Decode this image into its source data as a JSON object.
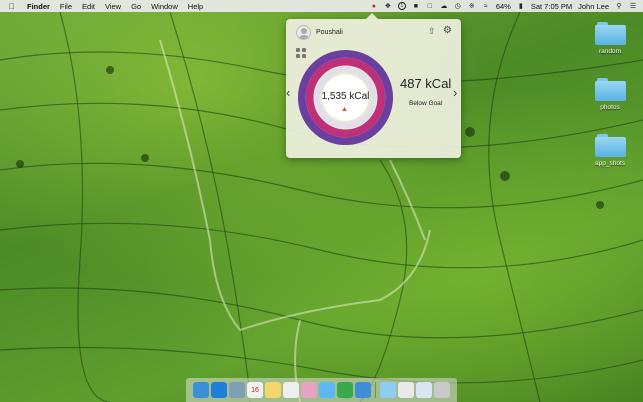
{
  "menubar": {
    "app_name": "Finder",
    "menus": [
      "File",
      "Edit",
      "View",
      "Go",
      "Window",
      "Help"
    ],
    "battery": "64%",
    "clock": "Sat 7:05 PM",
    "user": "John Lee"
  },
  "popover": {
    "user_name": "Poushali",
    "calories_consumed": "1,535 kCal",
    "remaining": "487 kCal",
    "status": "Below Goal",
    "ring_colors": {
      "outer": "#6a3fa0",
      "inner": "#c0307a",
      "track": "#e4ddef"
    }
  },
  "desktop": {
    "items": [
      "random",
      "photos",
      "app_shots"
    ]
  },
  "dock": {
    "apps": [
      {
        "icon": "finder-icon",
        "color": "#3b8fd6"
      },
      {
        "icon": "safari-icon",
        "color": "#1f7fd8"
      },
      {
        "icon": "mail-icon",
        "color": "#7f9fb8"
      },
      {
        "icon": "calendar-icon",
        "color": "#f2f2f2",
        "text": "16"
      },
      {
        "icon": "notes-icon",
        "color": "#f4d66a"
      },
      {
        "icon": "reminders-icon",
        "color": "#eeeeee"
      },
      {
        "icon": "photos-icon",
        "color": "#e6a3c4"
      },
      {
        "icon": "messages-icon",
        "color": "#5ab9f5"
      },
      {
        "icon": "facetime-icon",
        "color": "#3ba94a"
      },
      {
        "icon": "xcode-icon",
        "color": "#3d8ed6"
      },
      {
        "icon": "folder-icon",
        "color": "#8ecdf0"
      },
      {
        "icon": "preview-icon",
        "color": "#e9e9e9"
      },
      {
        "icon": "document-icon",
        "color": "#d9e6f2"
      },
      {
        "icon": "trash-icon",
        "color": "#c9c9c9"
      }
    ]
  }
}
